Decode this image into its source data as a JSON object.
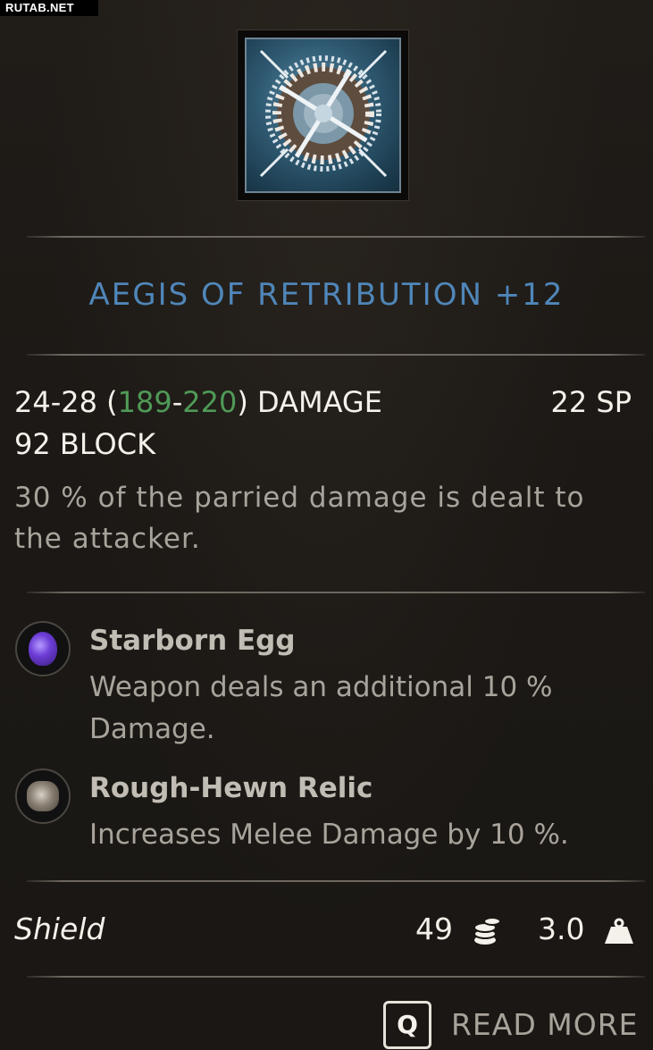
{
  "watermark": "RUTAB.NET",
  "item": {
    "name": "AEGIS OF RETRIBUTION +12",
    "stats": {
      "damage_base_min": "24",
      "damage_base_max": "28",
      "damage_scaled_min": "189",
      "damage_scaled_max": "220",
      "damage_label": "DAMAGE",
      "sp": "22 SP",
      "block": "92 BLOCK"
    },
    "effect": "30 % of the parried damage is dealt to the attacker.",
    "modifiers": [
      {
        "name": "Starborn Egg",
        "description": "Weapon deals an additional 10 % Damage.",
        "icon": "starborn-egg-icon"
      },
      {
        "name": "Rough-Hewn Relic",
        "description": "Increases Melee Damage by 10 %.",
        "icon": "rough-hewn-relic-icon"
      }
    ],
    "type": "Shield",
    "value": "49",
    "weight": "3.0"
  },
  "footer": {
    "key": "Q",
    "action": "READ MORE"
  },
  "colors": {
    "title": "#4f86b9",
    "scaled_damage": "#4f9a57",
    "text": "#f4f1ea",
    "muted": "#a8a39b"
  }
}
